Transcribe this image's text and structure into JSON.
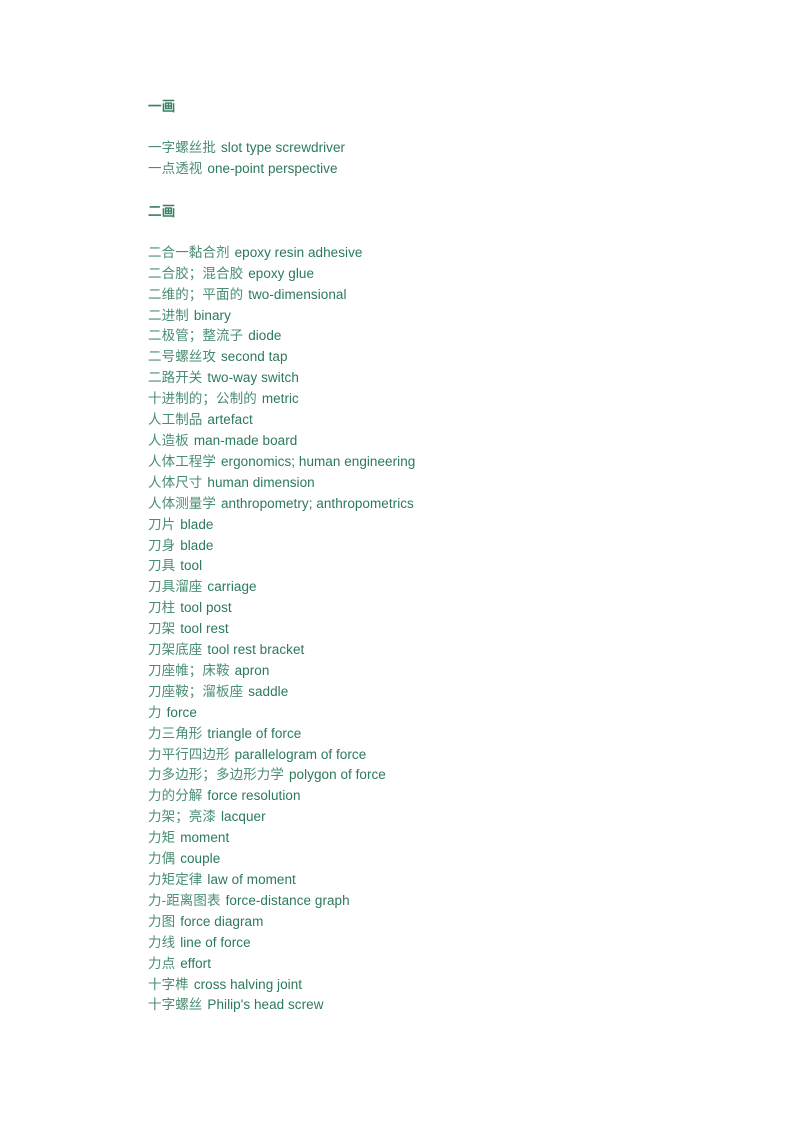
{
  "document": {
    "text_color": "#2f7d5d",
    "background_color": "#ffffff",
    "sections": [
      {
        "heading": "一画",
        "entries": [
          {
            "zh": "一字螺丝批",
            "en": "slot type screwdriver"
          },
          {
            "zh": "一点透视",
            "en": "one-point perspective"
          }
        ]
      },
      {
        "heading": "二画",
        "entries": [
          {
            "zh": "二合一黏合剂",
            "en": "epoxy resin adhesive"
          },
          {
            "zh": "二合胶；混合胶",
            "en": "epoxy glue"
          },
          {
            "zh": "二维的；平面的",
            "en": "two-dimensional"
          },
          {
            "zh": "二进制",
            "en": "binary"
          },
          {
            "zh": "二极管；整流子",
            "en": "diode"
          },
          {
            "zh": "二号螺丝攻",
            "en": "second tap"
          },
          {
            "zh": "二路开关",
            "en": "two-way switch"
          },
          {
            "zh": "十进制的；公制的",
            "en": "metric"
          },
          {
            "zh": "人工制品",
            "en": "artefact"
          },
          {
            "zh": "人造板",
            "en": "man-made board"
          },
          {
            "zh": "人体工程学",
            "en": "ergonomics; human engineering"
          },
          {
            "zh": "人体尺寸",
            "en": "human dimension"
          },
          {
            "zh": "人体测量学",
            "en": "anthropometry; anthropometrics"
          },
          {
            "zh": "刀片",
            "en": "blade"
          },
          {
            "zh": "刀身",
            "en": "blade"
          },
          {
            "zh": "刀具",
            "en": "tool"
          },
          {
            "zh": "刀具溜座",
            "en": "carriage"
          },
          {
            "zh": "刀柱",
            "en": "tool post"
          },
          {
            "zh": "刀架",
            "en": "tool rest"
          },
          {
            "zh": "刀架底座",
            "en": "tool rest bracket"
          },
          {
            "zh": "刀座帷；床鞍",
            "en": "apron"
          },
          {
            "zh": "刀座鞍；溜板座",
            "en": "saddle"
          },
          {
            "zh": "力",
            "en": "force"
          },
          {
            "zh": "力三角形",
            "en": "triangle of force"
          },
          {
            "zh": "力平行四边形",
            "en": "parallelogram of force"
          },
          {
            "zh": "力多边形；多边形力学",
            "en": "polygon of force"
          },
          {
            "zh": "力的分解",
            "en": "force resolution"
          },
          {
            "zh": "力架；亮漆",
            "en": "lacquer"
          },
          {
            "zh": "力矩",
            "en": "moment"
          },
          {
            "zh": "力偶",
            "en": "couple"
          },
          {
            "zh": "力矩定律",
            "en": "law of moment"
          },
          {
            "zh": "力-距离图表",
            "en": "force-distance graph"
          },
          {
            "zh": "力图",
            "en": "force diagram"
          },
          {
            "zh": "力线",
            "en": "line of force"
          },
          {
            "zh": "力点",
            "en": "effort"
          },
          {
            "zh": "十字榫",
            "en": "cross halving joint"
          },
          {
            "zh": "十字螺丝",
            "en": "Philip's head screw"
          }
        ]
      }
    ]
  }
}
